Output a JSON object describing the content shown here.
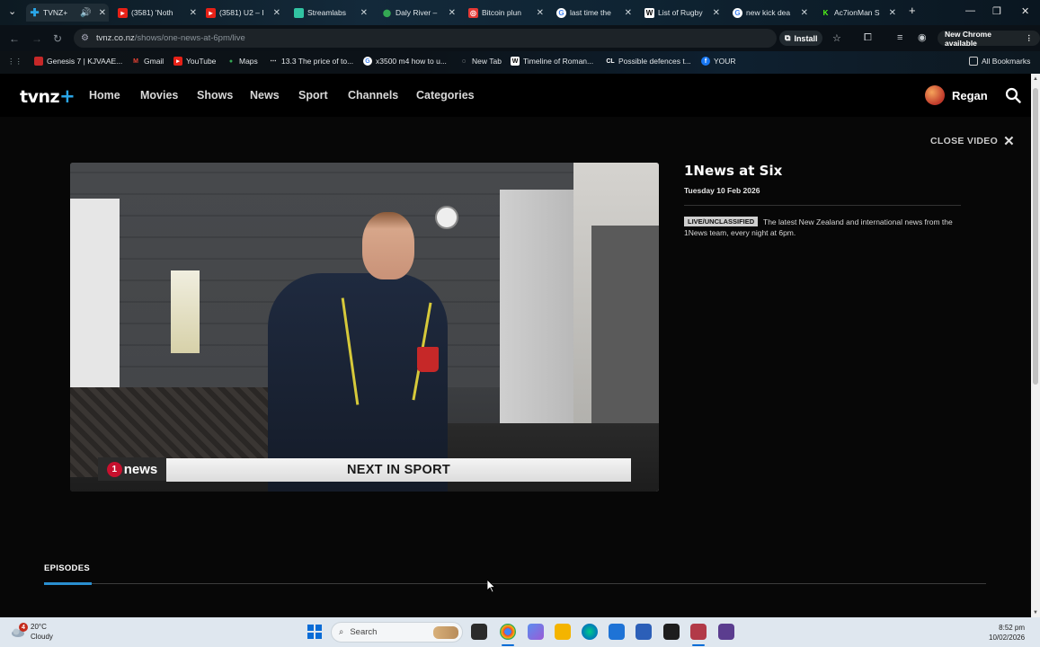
{
  "browser": {
    "tabs": [
      {
        "label": "TVNZ+",
        "active": true
      },
      {
        "label": "(3581) 'Noth"
      },
      {
        "label": "(3581) U2 – I"
      },
      {
        "label": "Streamlabs"
      },
      {
        "label": "Daly River –"
      },
      {
        "label": "Bitcoin plun"
      },
      {
        "label": "last time the"
      },
      {
        "label": "List of Rugby"
      },
      {
        "label": "new kick dea"
      },
      {
        "label": "Ac7ionMan S"
      }
    ],
    "url_host": "tvnz.co.nz",
    "url_path": "/shows/one-news-at-6pm/live",
    "install_label": "Install",
    "new_chrome_label": "New Chrome available",
    "bookmarks": [
      "Genesis 7 | KJVAAE...",
      "Gmail",
      "YouTube",
      "Maps",
      "13.3 The price of to...",
      "x3500 m4 how to u...",
      "New Tab",
      "Timeline of Roman...",
      "Possible defences t...",
      "YOUR"
    ],
    "all_bookmarks_label": "All Bookmarks"
  },
  "site": {
    "logo_text": "tvnz",
    "logo_plus": "+",
    "nav": [
      "Home",
      "Movies",
      "Shows",
      "News",
      "Sport",
      "Channels",
      "Categories"
    ],
    "user_name": "Regan",
    "close_video_label": "CLOSE VIDEO",
    "video": {
      "channel_logo": "news",
      "channel_logo_num": "1",
      "lower_third": "NEXT IN SPORT"
    },
    "show": {
      "title": "1News at Six",
      "date": "Tuesday 10 Feb 2026",
      "classification": "LIVE/UNCLASSIFIED",
      "synopsis": "The latest New Zealand and international news from the 1News team, every night at 6pm."
    },
    "episodes_tab": "EPISODES"
  },
  "taskbar": {
    "weather_temp": "20°C",
    "weather_desc": "Cloudy",
    "weather_badge": "4",
    "search_placeholder": "Search",
    "time": "8:52 pm",
    "date": "10/02/2026"
  },
  "colors": {
    "accent": "#2a8fd0",
    "tvnz_plus": "#2aa6e8"
  }
}
